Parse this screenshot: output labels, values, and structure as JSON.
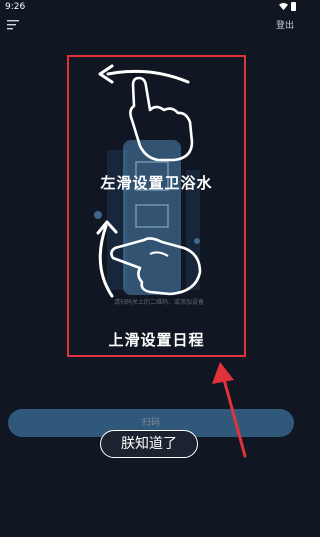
{
  "status_bar": {
    "time": "9:26"
  },
  "header": {
    "logout_label": "登出"
  },
  "overlay": {
    "left_swipe_label": "左滑设置卫浴水",
    "up_swipe_label": "上滑设置日程",
    "hint_text": "请扫码关上的二维码，或添加设备"
  },
  "actions": {
    "scan_label": "扫码",
    "got_it_label": "朕知道了"
  },
  "colors": {
    "background": "#101722",
    "highlight_frame": "#e0323a",
    "scan_bar": "#4a8ec5"
  },
  "icons": {
    "menu": "menu-icon",
    "wifi": "wifi-icon",
    "battery": "battery-icon",
    "left_arrow": "arrow-left-icon",
    "up_arrow": "arrow-up-icon",
    "hand": "hand-pointer-icon"
  }
}
